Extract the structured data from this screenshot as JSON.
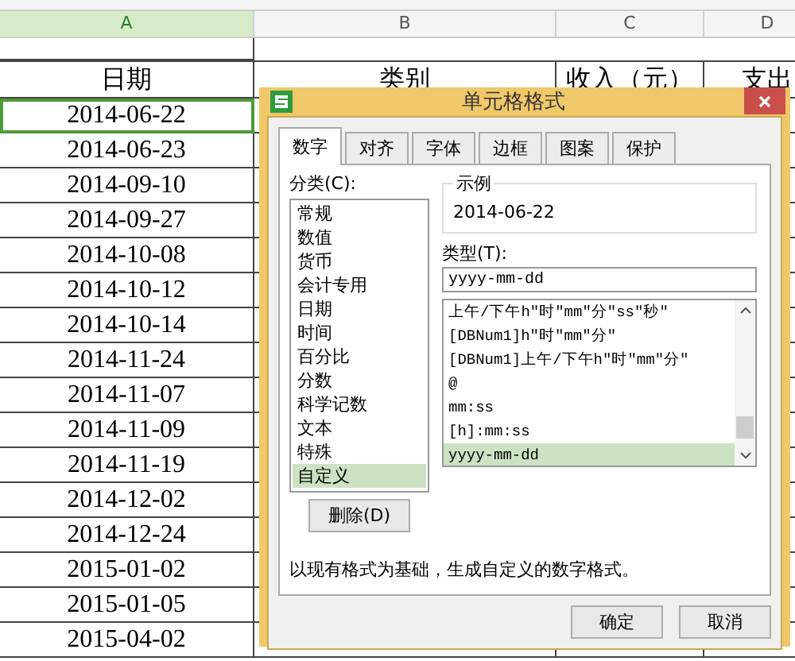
{
  "sheet": {
    "columns": [
      {
        "label": "A",
        "selected": true
      },
      {
        "label": "B",
        "selected": false
      },
      {
        "label": "C",
        "selected": false
      },
      {
        "label": "D",
        "selected": false
      }
    ],
    "header": [
      "日期",
      "类别",
      "收入（元）",
      "支出"
    ],
    "dates": [
      "2014-06-22",
      "2014-06-23",
      "2014-09-10",
      "2014-09-27",
      "2014-10-08",
      "2014-10-12",
      "2014-10-14",
      "2014-11-24",
      "2014-11-07",
      "2014-11-09",
      "2014-11-19",
      "2014-12-02",
      "2014-12-24",
      "2015-01-02",
      "2015-01-05",
      "2015-04-02"
    ]
  },
  "dialog": {
    "title": "单元格格式",
    "tabs": [
      {
        "label": "数字",
        "selected": true
      },
      {
        "label": "对齐",
        "selected": false
      },
      {
        "label": "字体",
        "selected": false
      },
      {
        "label": "边框",
        "selected": false
      },
      {
        "label": "图案",
        "selected": false
      },
      {
        "label": "保护",
        "selected": false
      }
    ],
    "category_label": "分类(C):",
    "categories": [
      {
        "label": "常规",
        "selected": false
      },
      {
        "label": "数值",
        "selected": false
      },
      {
        "label": "货币",
        "selected": false
      },
      {
        "label": "会计专用",
        "selected": false
      },
      {
        "label": "日期",
        "selected": false
      },
      {
        "label": "时间",
        "selected": false
      },
      {
        "label": "百分比",
        "selected": false
      },
      {
        "label": "分数",
        "selected": false
      },
      {
        "label": "科学记数",
        "selected": false
      },
      {
        "label": "文本",
        "selected": false
      },
      {
        "label": "特殊",
        "selected": false
      },
      {
        "label": "自定义",
        "selected": true
      }
    ],
    "sample_label": "示例",
    "sample": "2014-06-22",
    "type_label": "类型(T):",
    "type_value": "yyyy-mm-dd",
    "formats": [
      {
        "label": "上午/下午h\"时\"mm\"分\"ss\"秒\"",
        "selected": false
      },
      {
        "label": "[DBNum1]h\"时\"mm\"分\"",
        "selected": false
      },
      {
        "label": "[DBNum1]上午/下午h\"时\"mm\"分\"",
        "selected": false
      },
      {
        "label": "@",
        "selected": false
      },
      {
        "label": "mm:ss",
        "selected": false
      },
      {
        "label": "[h]:mm:ss",
        "selected": false
      },
      {
        "label": "yyyy-mm-dd",
        "selected": true
      }
    ],
    "delete_button": "删除(D)",
    "description": "以现有格式为基础，生成自定义的数字格式。",
    "buttons": [
      "确定",
      "取消"
    ]
  }
}
